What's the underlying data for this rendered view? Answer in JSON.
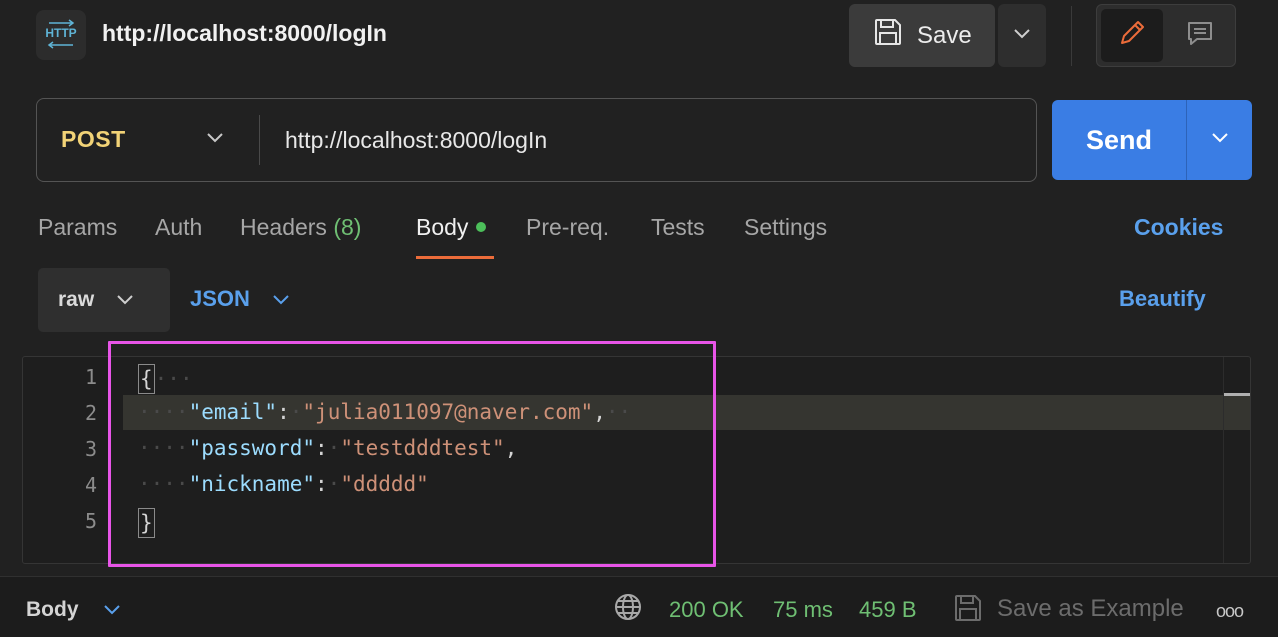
{
  "request": {
    "title": "http://localhost:8000/logIn",
    "method": "POST",
    "url": "http://localhost:8000/logIn",
    "save_label": "Save",
    "send_label": "Send"
  },
  "tabs": {
    "params": "Params",
    "auth": "Auth",
    "headers": "Headers",
    "headers_count": "(8)",
    "body": "Body",
    "prereq": "Pre-req.",
    "tests": "Tests",
    "settings": "Settings",
    "cookies": "Cookies"
  },
  "body_options": {
    "mode": "raw",
    "format": "JSON",
    "beautify": "Beautify"
  },
  "editor": {
    "line_numbers": [
      "1",
      "2",
      "3",
      "4",
      "5"
    ],
    "open_brace": "{",
    "close_brace": "}",
    "lines": [
      {
        "key": "\"email\"",
        "value": "\"julia011097@naver.com\"",
        "trail": ","
      },
      {
        "key": "\"password\"",
        "value": "\"testdddtest\"",
        "trail": ","
      },
      {
        "key": "\"nickname\"",
        "value": "\"ddddd\"",
        "trail": ""
      }
    ]
  },
  "status_bar": {
    "panel": "Body",
    "status": "200 OK",
    "time": "75 ms",
    "size": "459 B",
    "save_example": "Save as Example",
    "more": "ooo"
  },
  "colors": {
    "accent": "#3a7de4",
    "method": "#f2d377",
    "success": "#6fbf73",
    "link": "#5aa0ec",
    "active_tab": "#ec6c3a",
    "highlight_box": "#e855e8"
  },
  "icons": {
    "request_type": "http-icon",
    "save": "floppy-disk-icon",
    "edit": "pencil-icon",
    "comment": "comment-icon",
    "network": "globe-icon"
  }
}
